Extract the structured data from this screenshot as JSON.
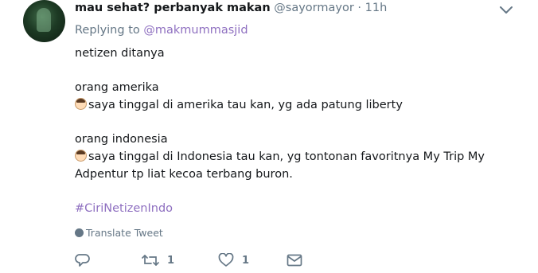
{
  "tweet": {
    "author_name": "mau sehat? perbanyak makan",
    "author_handle": "@sayormayor",
    "separator": "·",
    "time": "11h",
    "replying_to_label": "Replying to",
    "replying_to_handle": "@makmummasjid",
    "lines": {
      "l1": "netizen ditanya",
      "l2": "orang amerika",
      "l3": "saya tinggal di amerika tau kan, yg ada patung liberty",
      "l4": "orang indonesia",
      "l5": "saya tinggal di Indonesia tau kan, yg tontonan favoritnya My Trip My",
      "l6": "Adpentur tp liat kecoa terbang buron."
    },
    "hashtag": "#CiriNetizenIndo",
    "translate_label": "Translate Tweet",
    "retweet_count": "1",
    "like_count": "1"
  },
  "colors": {
    "text": "#14171a",
    "muted": "#657786",
    "accent": "#8e6fc0"
  },
  "icons": {
    "menu": "chevron-down-icon",
    "translate": "globe-icon",
    "reply": "reply-icon",
    "retweet": "retweet-icon",
    "like": "heart-icon",
    "dm": "envelope-icon",
    "emoji": "man-face-emoji"
  }
}
